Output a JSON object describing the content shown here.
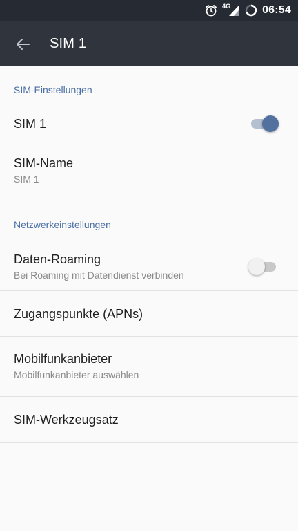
{
  "status_bar": {
    "time": "06:54",
    "network_label": "4G",
    "icons": [
      "alarm-icon",
      "signal-icon",
      "battery-icon"
    ]
  },
  "app_bar": {
    "title": "SIM 1",
    "back_icon": "arrow-left-icon"
  },
  "sections": {
    "sim_settings": {
      "header": "SIM-Einstellungen",
      "sim_toggle": {
        "title": "SIM 1",
        "checked": true
      },
      "sim_name": {
        "title": "SIM-Name",
        "summary": "SIM 1"
      }
    },
    "network_settings": {
      "header": "Netzwerkeinstellungen",
      "roaming": {
        "title": "Daten-Roaming",
        "summary": "Bei Roaming mit Datendienst verbinden",
        "checked": false
      },
      "apn": {
        "title": "Zugangspunkte (APNs)"
      },
      "carrier": {
        "title": "Mobilfunkanbieter",
        "summary": "Mobilfunkanbieter auswählen"
      },
      "sim_toolkit": {
        "title": "SIM-Werkzeugsatz"
      }
    }
  },
  "colors": {
    "status_bar_bg": "#262b33",
    "app_bar_bg": "#2f343d",
    "accent": "#52719f",
    "section_header": "#4b6fa5",
    "background": "#fafafa"
  }
}
